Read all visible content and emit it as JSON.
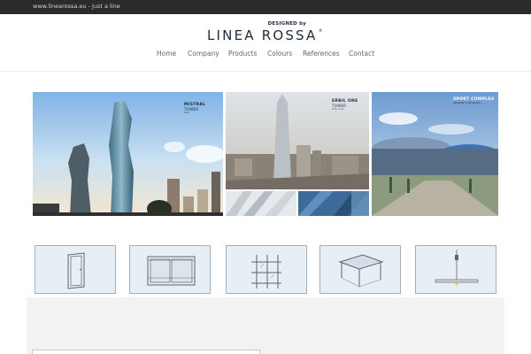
{
  "topbar": {
    "text": "www.linearossa.eu - just a line"
  },
  "logo": {
    "small": "DESIGNED by",
    "main": "LINEA ROSSA",
    "reg": "®"
  },
  "nav": {
    "items": [
      {
        "label": "Home"
      },
      {
        "label": "Company"
      },
      {
        "label": "Products"
      },
      {
        "label": "Colours"
      },
      {
        "label": "References"
      },
      {
        "label": "Contact"
      }
    ]
  },
  "gallery": {
    "mistral": {
      "title": "MISTRAL",
      "subtitle": "TOWER",
      "tiny": "Baku"
    },
    "erbil": {
      "title": "ERBIL ONE",
      "subtitle": "TOWER",
      "tiny": "Erbil / Iraq"
    },
    "sport": {
      "title": "SPORT COMPLEX",
      "tiny": "Ashgabat, Turkmenistan"
    }
  },
  "tiles": [
    {
      "icon": "window-icon"
    },
    {
      "icon": "sliding-door-icon"
    },
    {
      "icon": "facade-grid-icon"
    },
    {
      "icon": "pergola-icon"
    },
    {
      "icon": "pendant-lamp-icon"
    }
  ],
  "colors": {
    "topbar": "#2b2b2b",
    "brand": "#1c2a3b",
    "tile_bg": "#e8eef5",
    "tile_border": "#9fb0c1"
  }
}
